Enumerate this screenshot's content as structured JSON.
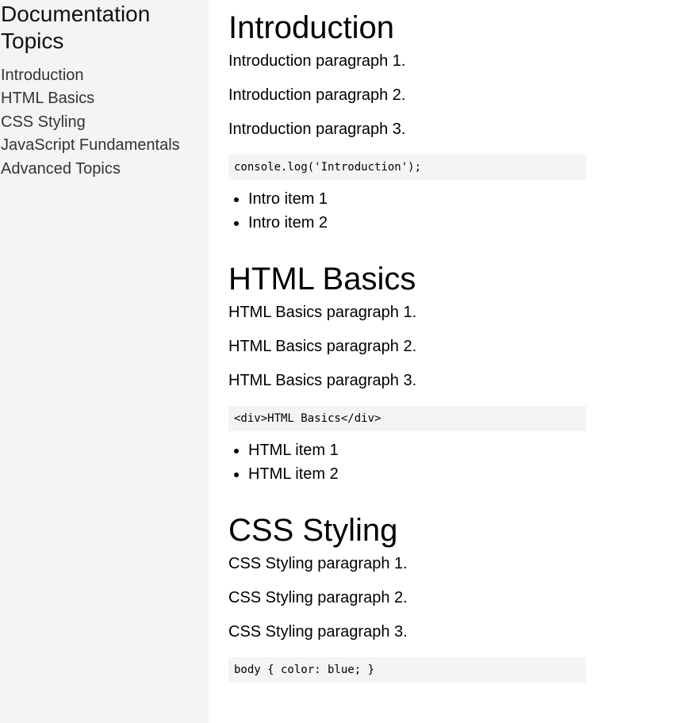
{
  "sidebar": {
    "title": "Documentation Topics",
    "items": [
      {
        "label": "Introduction"
      },
      {
        "label": "HTML Basics"
      },
      {
        "label": "CSS Styling"
      },
      {
        "label": "JavaScript Fundamentals"
      },
      {
        "label": "Advanced Topics"
      }
    ]
  },
  "sections": [
    {
      "heading": "Introduction",
      "paragraphs": [
        "Introduction paragraph 1.",
        "Introduction paragraph 2.",
        "Introduction paragraph 3."
      ],
      "code": "console.log('Introduction');",
      "list": [
        "Intro item 1",
        "Intro item 2"
      ]
    },
    {
      "heading": "HTML Basics",
      "paragraphs": [
        "HTML Basics paragraph 1.",
        "HTML Basics paragraph 2.",
        "HTML Basics paragraph 3."
      ],
      "code": "<div>HTML Basics</div>",
      "list": [
        "HTML item 1",
        "HTML item 2"
      ]
    },
    {
      "heading": "CSS Styling",
      "paragraphs": [
        "CSS Styling paragraph 1.",
        "CSS Styling paragraph 2.",
        "CSS Styling paragraph 3."
      ],
      "code": "body { color: blue; }",
      "list": []
    }
  ]
}
